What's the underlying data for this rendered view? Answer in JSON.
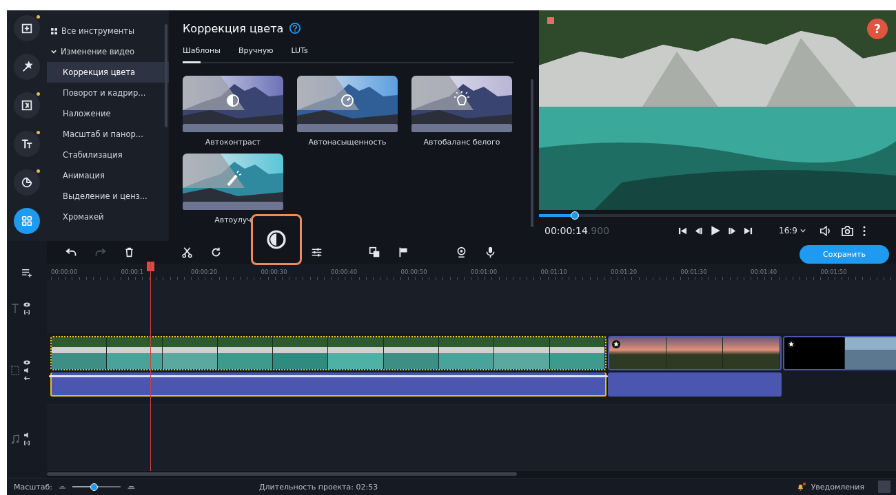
{
  "rail": [
    {
      "kind": "import",
      "dot": true,
      "selected": false
    },
    {
      "kind": "wand",
      "dot": false,
      "selected": false
    },
    {
      "kind": "transitions",
      "dot": true,
      "selected": false
    },
    {
      "kind": "text",
      "dot": true,
      "selected": false
    },
    {
      "kind": "sticker",
      "dot": true,
      "selected": false
    },
    {
      "kind": "tools",
      "dot": false,
      "selected": true
    }
  ],
  "nav": {
    "all_tools": "Все инструменты",
    "group": {
      "label": "Изменение видео",
      "expanded": true,
      "children": [
        {
          "label": "Коррекция цвета",
          "selected": true
        },
        {
          "label": "Поворот и кадрир...",
          "selected": false
        },
        {
          "label": "Наложение",
          "selected": false
        },
        {
          "label": "Масштаб и панор...",
          "selected": false
        },
        {
          "label": "Стабилизация",
          "selected": false
        },
        {
          "label": "Анимация",
          "selected": false
        },
        {
          "label": "Выделение и ценз...",
          "selected": false
        },
        {
          "label": "Хромакей",
          "selected": false
        }
      ]
    }
  },
  "panel": {
    "title": "Коррекция цвета",
    "tabs": [
      {
        "label": "Шаблоны",
        "selected": true
      },
      {
        "label": "Вручную",
        "selected": false
      },
      {
        "label": "LUTs",
        "selected": false
      }
    ],
    "presets": [
      {
        "label": "Автоконтраст",
        "kind": "contrast"
      },
      {
        "label": "Автонасыщенность",
        "kind": "saturation"
      },
      {
        "label": "Автобаланс белого",
        "kind": "white_balance"
      },
      {
        "label": "Автоулуч",
        "kind": "enhance"
      }
    ]
  },
  "preview": {
    "help": "?",
    "progress": {
      "level": 0.1
    },
    "time": "00:00:14",
    "time_fraction": ".900",
    "aspect": "16:9"
  },
  "toolbar": [
    {
      "kind": "undo",
      "disabled": false,
      "highlighted": false
    },
    {
      "kind": "redo",
      "disabled": true,
      "highlighted": false
    },
    {
      "kind": "delete",
      "disabled": false,
      "highlighted": false
    },
    {
      "kind": "cut",
      "disabled": false,
      "highlighted": false
    },
    {
      "kind": "rotate",
      "disabled": false,
      "highlighted": false
    },
    {
      "kind": "contrast",
      "disabled": false,
      "highlighted": true
    },
    {
      "kind": "adjust",
      "disabled": false,
      "highlighted": false
    },
    {
      "kind": "overlay",
      "disabled": false,
      "highlighted": false
    },
    {
      "kind": "flag",
      "disabled": false,
      "highlighted": false
    },
    {
      "kind": "webcam",
      "disabled": false,
      "highlighted": false
    },
    {
      "kind": "mic",
      "disabled": false,
      "highlighted": false
    }
  ],
  "save_button": "Сохранить",
  "ruler": [
    "00:00:00",
    "00:00:1",
    "00:00:20",
    "00:00:30",
    "00:00:40",
    "00:00:50",
    "00:01:00",
    "00:01:10",
    "00:01:20",
    "00:01:30",
    "00:01:40",
    "00:01:50"
  ],
  "clips": [
    {
      "kind": "sea",
      "selected": true,
      "starred": false,
      "audio": true
    },
    {
      "kind": "sunset",
      "selected": false,
      "starred": true,
      "audio": true
    },
    {
      "kind": "photo",
      "selected": false,
      "starred": true,
      "audio": false
    }
  ],
  "status": {
    "zoom_label": "Масштаб:",
    "zoom": {
      "level": 0.45
    },
    "duration": "Длительность проекта: 02:53",
    "notifications": "Уведомления",
    "notification_dot": true
  }
}
